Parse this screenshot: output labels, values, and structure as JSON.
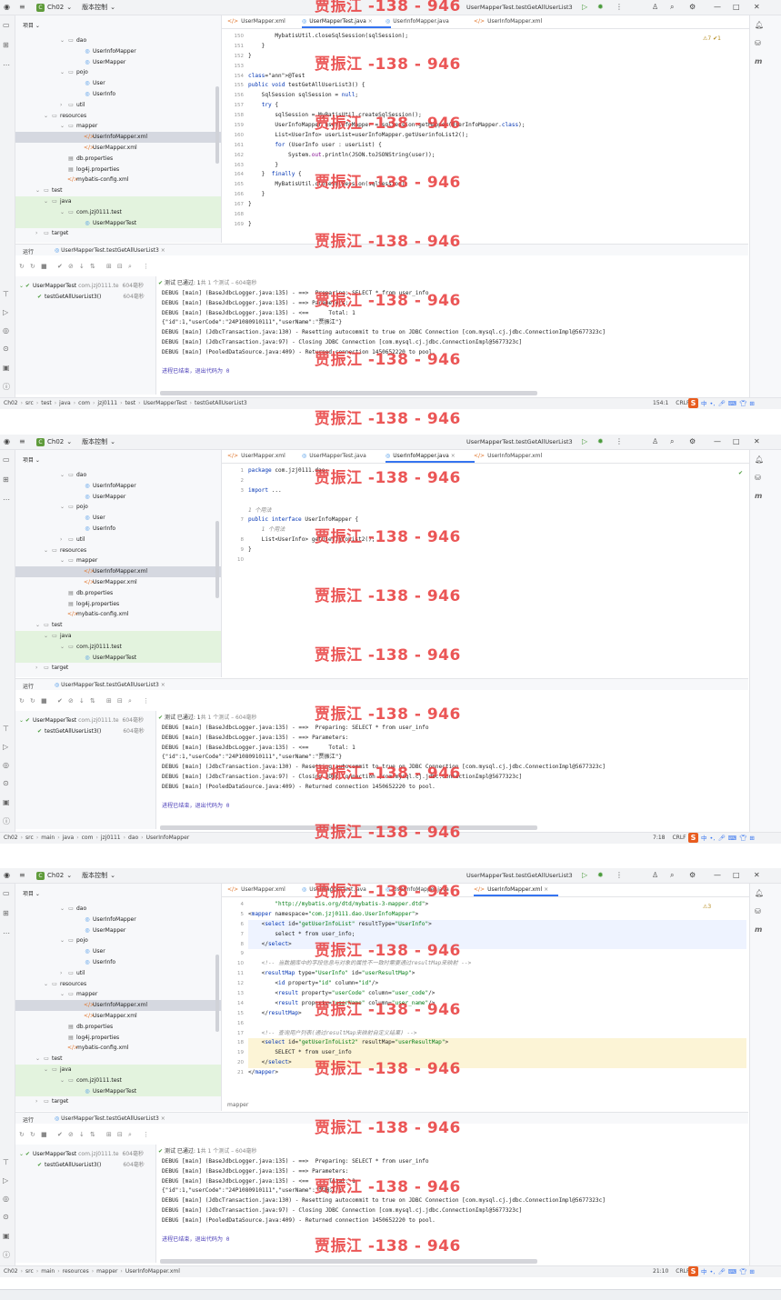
{
  "app": {
    "project_name": "Ch02",
    "project_badge": "C",
    "vcs_label": "版本控制",
    "window_title": "UserMapperTest.testGetAllUserList3",
    "project_header": "项目"
  },
  "tree": [
    {
      "label": "dao",
      "icon": "folder-icon",
      "indent": 5,
      "sel": false,
      "test": false
    },
    {
      "label": "UserInfoMapper",
      "icon": "interface-icon",
      "indent": 7,
      "sel": false,
      "test": false
    },
    {
      "label": "UserMapper",
      "icon": "interface-icon",
      "indent": 7,
      "sel": false,
      "test": false
    },
    {
      "label": "pojo",
      "icon": "folder-icon",
      "indent": 5,
      "sel": false,
      "test": false
    },
    {
      "label": "User",
      "icon": "class-icon",
      "indent": 7,
      "sel": false,
      "test": false
    },
    {
      "label": "UserInfo",
      "icon": "class-icon",
      "indent": 7,
      "sel": false,
      "test": false
    },
    {
      "label": "util",
      "icon": "folder-icon",
      "indent": 5,
      "sel": false,
      "test": false
    },
    {
      "label": "resources",
      "icon": "folder-icon",
      "indent": 3,
      "sel": false,
      "test": false
    },
    {
      "label": "mapper",
      "icon": "folder-icon",
      "indent": 5,
      "sel": false,
      "test": false
    },
    {
      "label": "UserInfoMapper.xml",
      "icon": "xml-icon",
      "indent": 7,
      "sel": true,
      "test": false
    },
    {
      "label": "UserMapper.xml",
      "icon": "xml-icon",
      "indent": 7,
      "sel": false,
      "test": false
    },
    {
      "label": "db.properties",
      "icon": "properties-icon",
      "indent": 5,
      "sel": false,
      "test": false
    },
    {
      "label": "log4j.properties",
      "icon": "properties-icon",
      "indent": 5,
      "sel": false,
      "test": false
    },
    {
      "label": "mybatis-config.xml",
      "icon": "xml-icon",
      "indent": 5,
      "sel": false,
      "test": false
    },
    {
      "label": "test",
      "icon": "folder-icon",
      "indent": 2,
      "sel": false,
      "test": false
    },
    {
      "label": "java",
      "icon": "folder-icon",
      "indent": 3,
      "sel": false,
      "test": true
    },
    {
      "label": "com.jzj0111.test",
      "icon": "folder-icon",
      "indent": 5,
      "sel": false,
      "test": true
    },
    {
      "label": "UserMapperTest",
      "icon": "class-icon",
      "indent": 7,
      "sel": false,
      "test": true
    },
    {
      "label": "target",
      "icon": "folder-icon",
      "indent": 2,
      "sel": false,
      "test": false
    }
  ],
  "tabs": [
    {
      "label": "UserMapper.xml",
      "icon": "xml-icon"
    },
    {
      "label": "UserMapperTest.java",
      "icon": "class-icon"
    },
    {
      "label": "UserInfoMapper.java",
      "icon": "interface-icon"
    },
    {
      "label": "UserInfoMapper.xml",
      "icon": "xml-icon"
    }
  ],
  "run": {
    "tab_label": "运行",
    "config": "UserMapperTest.testGetAllUserList3",
    "summary_ok": "测试 已通过: 1",
    "summary_rest": "共 1 个测试 – 604毫秒",
    "root": "UserMapperTest",
    "root_pkg": "com.jzj0111.te",
    "root_time": "604毫秒",
    "child": "testGetAllUserList3()",
    "child_time": "604毫秒",
    "log": [
      "DEBUG [main] (BaseJdbcLogger.java:135) - ==>  Preparing: SELECT * from user_info",
      "DEBUG [main] (BaseJdbcLogger.java:135) - ==> Parameters: ",
      "DEBUG [main] (BaseJdbcLogger.java:135) - <==      Total: 1",
      "{\"id\":1,\"userCode\":\"24P1080910111\",\"userName\":\"贾振江\"}",
      "DEBUG [main] (JdbcTransaction.java:130) - Resetting autocommit to true on JDBC Connection [com.mysql.cj.jdbc.ConnectionImpl@5677323c]",
      "DEBUG [main] (JdbcTransaction.java:97) - Closing JDBC Connection [com.mysql.cj.jdbc.ConnectionImpl@5677323c]",
      "DEBUG [main] (PooledDataSource.java:409) - Returned connection 1450652220 to pool."
    ],
    "exit": "进程已结束，退出代码为 0"
  },
  "watermark": "贾振江 -138 - 946",
  "panels": [
    {
      "active_tab": 1,
      "inspection": "⚠7 ✔1",
      "gutter": [
        "150",
        "151",
        "152",
        "153",
        "154",
        "155",
        "156",
        "157",
        "158",
        "159",
        "160",
        "161",
        "162",
        "163",
        "164",
        "165",
        "166",
        "167",
        "168",
        "169"
      ],
      "code": [
        "        MybatisUtil.closeSqlSession(sqlSession);",
        "    }",
        "}",
        "",
        "@Test",
        "public void testGetAllUserList3() {",
        "    SqlSession sqlSession = null;",
        "    try {",
        "        sqlSession = MyBatisUtil.createSqlSession();",
        "        UserInfoMapper userInfoMapper = sqlSession.getMapper(UserInfoMapper.class);",
        "        List<UserInfo> userList=userInfoMapper.getUserinfoList2();",
        "        for (UserInfo user : userList) {",
        "            System.out.println(JSON.toJSONString(user));",
        "        }",
        "    }  finally {",
        "        MyBatisUtil.closeSqlSession(sqlSession);",
        "    }",
        "}",
        "",
        "}"
      ],
      "breadcrumb": [
        "Ch02",
        "src",
        "test",
        "java",
        "com",
        "jzj0111",
        "test",
        "UserMapperTest",
        "testGetAllUserList3"
      ],
      "position": "154:1",
      "encoding": "CRLF"
    },
    {
      "active_tab": 2,
      "inspection": "✔",
      "gutter": [
        "1",
        "2",
        "3",
        "",
        "",
        "7",
        "",
        "8",
        "9",
        "10"
      ],
      "code": [
        "package com.jzj0111.dao;",
        "",
        "import ...",
        "",
        "1 个用法",
        "public interface UserInfoMapper {",
        "    1 个用法",
        "    List<UserInfo> getUserinfoList2();",
        "}",
        ""
      ],
      "breadcrumb": [
        "Ch02",
        "src",
        "main",
        "java",
        "com",
        "jzj0111",
        "dao",
        "UserInfoMapper"
      ],
      "position": "7:18",
      "encoding": "CRLF"
    },
    {
      "active_tab": 3,
      "inspection": "⚠3",
      "gutter": [
        "4",
        "5",
        "6",
        "7",
        "8",
        "9",
        "10",
        "11",
        "12",
        "13",
        "14",
        "15",
        "16",
        "17",
        "18",
        "19",
        "20",
        "21"
      ],
      "code": [
        "        \"http://mybatis.org/dtd/mybatis-3-mapper.dtd\">",
        "<mapper namespace=\"com.jzj0111.dao.UserInfoMapper\">",
        "    <select id=\"getUserInfoList\" resultType=\"UserInfo\">",
        "        select * from user_info;",
        "    </select>",
        "",
        "    <!-- 当数据库中的字段信息与对象的属性不一致时需要通过resultMap来映射 -->",
        "    <resultMap type=\"UserInfo\" id=\"userResultMap\">",
        "        <id property=\"id\" column=\"id\"/>",
        "        <result property=\"userCode\" column=\"user_code\"/>",
        "        <result property=\"userName\" column=\"user_name\"/>",
        "    </resultMap>",
        "",
        "    <!-- 查询用户列表(通过resultMap来映射自定义结果) -->",
        "    <select id=\"getUserInfoList2\" resultMap=\"userResultMap\">",
        "        SELECT * from user_info",
        "    </select>",
        "</mapper>"
      ],
      "footer": "mapper",
      "breadcrumb": [
        "Ch02",
        "src",
        "main",
        "resources",
        "mapper",
        "UserInfoMapper.xml"
      ],
      "position": "21:10",
      "encoding": "CRLF"
    }
  ]
}
